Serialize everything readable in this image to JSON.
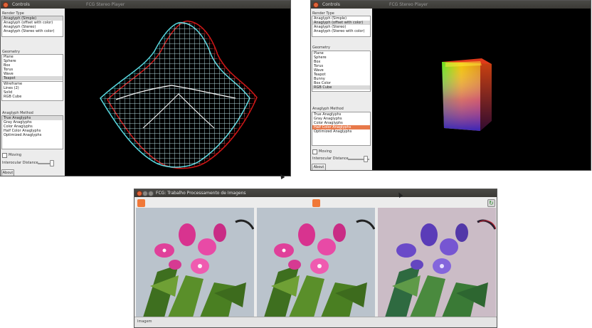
{
  "win1": {
    "title": "Controls",
    "subtitle": "FCG Stereo Player",
    "stereo_type_label": "Render Type",
    "stereo_types": [
      "Anaglyph (Simple)",
      "Anaglyph (offset with color)",
      "Anaglyph (Stereo)",
      "Anaglyph (Stereo with color)"
    ],
    "geometry_label": "Geometry",
    "geometry_items": [
      "Plane",
      "Sphere",
      "Box",
      "Torus",
      "Wave",
      "Teapot"
    ],
    "shading_items": [
      "Wireframe",
      "Lines (2)",
      "Solid",
      "RGB Cube"
    ],
    "method_label": "Anaglyph Method",
    "methods": [
      "True Anaglyphs",
      "Gray Anaglyphs",
      "Color Anaglyphs",
      "Half Color Anaglyphs",
      "Optimized Anaglyphs"
    ],
    "moving_label": "Moving",
    "distance_label": "Interocular Distance",
    "about_label": "About"
  },
  "win2": {
    "title": "Controls",
    "subtitle": "FCG Stereo Player",
    "render_type_label": "Render Type",
    "render_types": [
      "Anaglyph (Simple)",
      "Anaglyph (offset with color)",
      "Anaglyph (Stereo)",
      "Anaglyph (Stereo with color)"
    ],
    "geometry_label": "Geometry",
    "geometry_items": [
      "Plane",
      "Sphere",
      "Box",
      "Torus",
      "Wave",
      "Teapot",
      "Bunny",
      "Box Color",
      "RGB Cube"
    ],
    "method_label": "Anaglyph Method",
    "methods": [
      "True Anaglyphs",
      "Gray Anaglyphs",
      "Color Anaglyphs",
      "Half Color Anaglyphs",
      "Optimized Anaglyphs"
    ],
    "moving_label": "Moving",
    "distance_label": "Interocular Distance",
    "about_label": "About"
  },
  "win3": {
    "title": "FCG: Trabalho Processamento de Imagens",
    "status": "Imagem"
  },
  "colors": {
    "titlebar": "#3c3b37",
    "close_button": "#e0643a",
    "canvas": "#000000",
    "selection_orange": "#e8794a"
  }
}
